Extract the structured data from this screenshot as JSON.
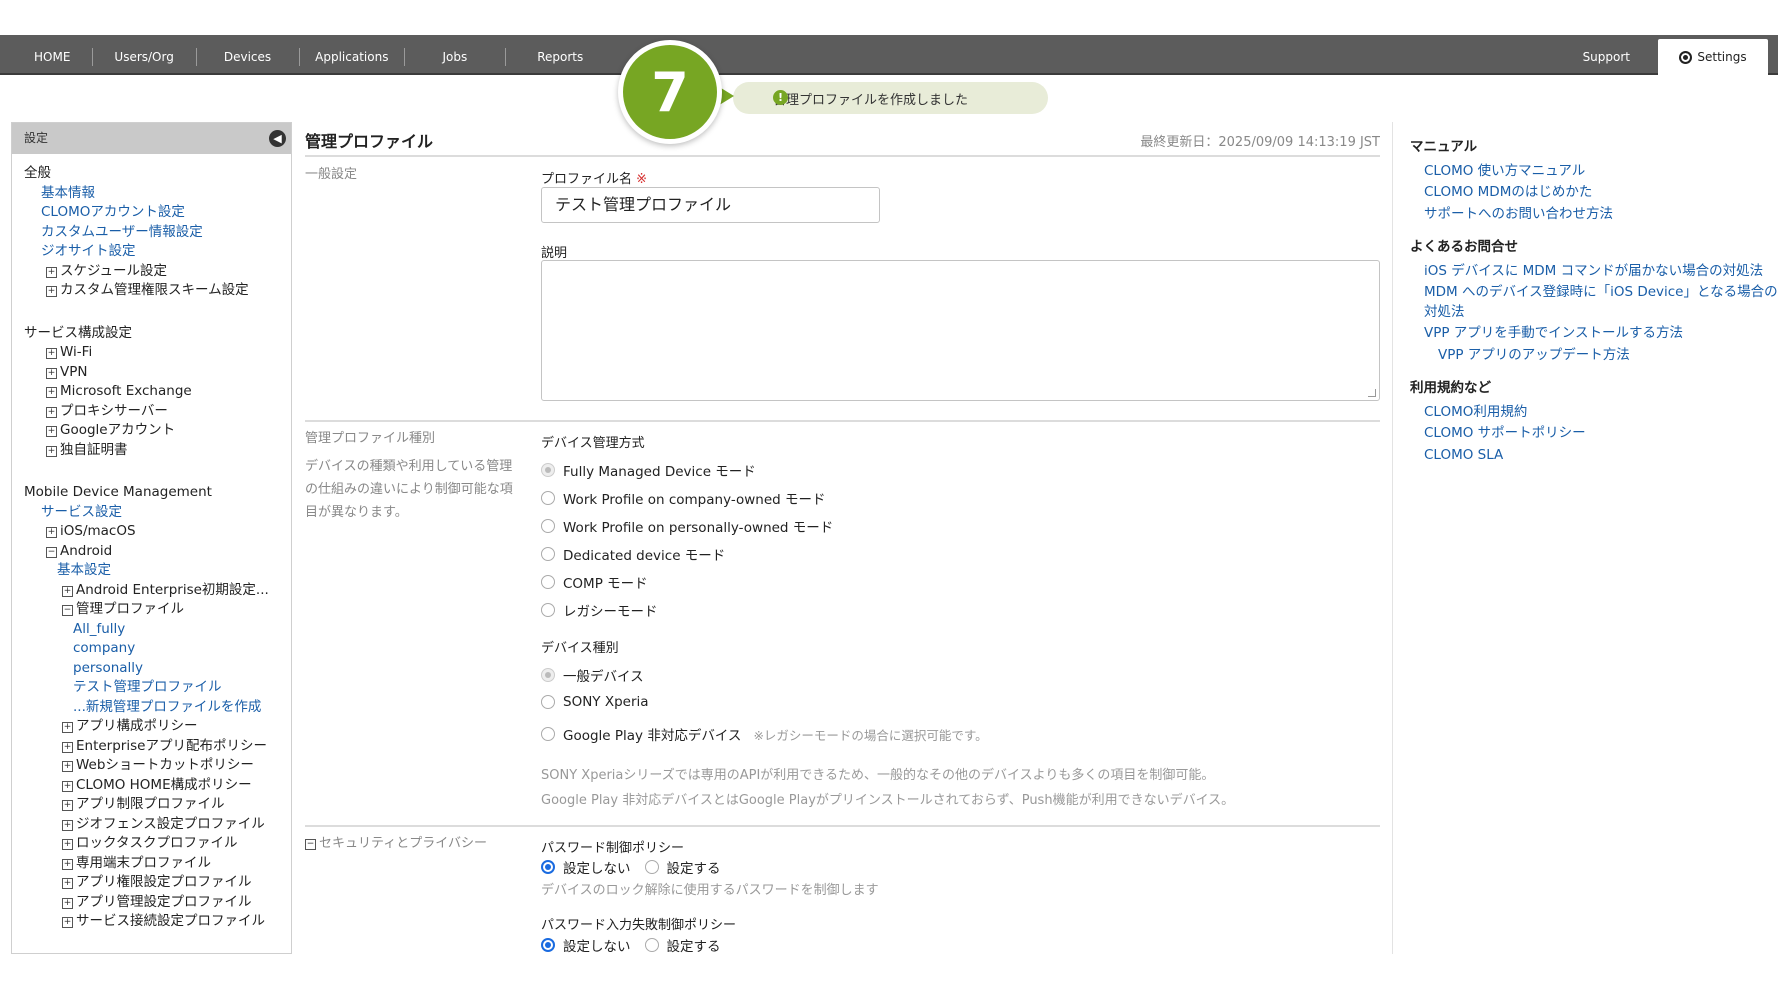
{
  "nav": {
    "items": [
      "HOME",
      "Users/Org",
      "Devices",
      "Applications",
      "Jobs",
      "Reports"
    ],
    "support": "Support",
    "settings": "Settings"
  },
  "callout": {
    "step": "7",
    "message": "管理プロファイルを作成しました"
  },
  "sidebar": {
    "header": "設定",
    "general": {
      "title": "全般",
      "links": [
        "基本情報",
        "CLOMOアカウント設定",
        "カスタムユーザー情報設定",
        "ジオサイト設定"
      ],
      "expandables": [
        "スケジュール設定",
        "カスタム管理権限スキーム設定"
      ]
    },
    "service": {
      "title": "サービス構成設定",
      "items": [
        "Wi-Fi",
        "VPN",
        "Microsoft Exchange",
        "プロキシサーバー",
        "Googleアカウント",
        "独自証明書"
      ]
    },
    "mdm": {
      "title": "Mobile Device Management",
      "service_settings": "サービス設定",
      "ios": "iOS/macOS",
      "android": "Android",
      "android_basic": "基本設定",
      "android_enterprise": "Android Enterprise初期設定...",
      "managed_profile": "管理プロファイル",
      "profiles": [
        "All_fully",
        "company",
        "personally",
        "テスト管理プロファイル",
        "...新規管理プロファイルを作成"
      ],
      "more": [
        "アプリ構成ポリシー",
        "Enterpriseアプリ配布ポリシー",
        "Webショートカットポリシー",
        "CLOMO HOME構成ポリシー",
        "アプリ制限プロファイル",
        "ジオフェンス設定プロファイル",
        "ロックタスクプロファイル",
        "専用端末プロファイル",
        "アプリ権限設定プロファイル",
        "アプリ管理設定プロファイル",
        "サービス接続設定プロファイル"
      ]
    }
  },
  "main": {
    "title": "管理プロファイル",
    "updated": "最終更新日：2025/09/09 14:13:19 JST",
    "general_section": "一般設定",
    "profile_name_label": "プロファイル名",
    "required_mark": "※",
    "profile_name_value": "テスト管理プロファイル",
    "description_label": "説明",
    "type_section": "管理プロファイル種別",
    "type_help": [
      "デバイスの種類や利用している管理",
      "の仕組みの違いにより制御可能な項",
      "目が異なります。"
    ],
    "mgmt_method_label": "デバイス管理方式",
    "mgmt_methods": [
      "Fully Managed Device モード",
      "Work Profile on company-owned モード",
      "Work Profile on personally-owned モード",
      "Dedicated device モード",
      "COMP モード",
      "レガシーモード"
    ],
    "device_type_label": "デバイス種別",
    "device_types": [
      "一般デバイス",
      "SONY Xperia",
      "Google Play 非対応デバイス"
    ],
    "device_type_note": "※レガシーモードの場合に選択可能です。",
    "device_help": [
      "SONY Xperiaシリーズでは専用のAPIが利用できるため、一般的なその他のデバイスよりも多くの項目を制御可能。",
      "Google Play 非対応デバイスとはGoogle Playがプリインストールされておらず、Push機能が利用できないデバイス。"
    ],
    "security_section": "セキュリティとプライバシー",
    "pw_policy_label": "パスワード制御ポリシー",
    "opt_off": "設定しない",
    "opt_on": "設定する",
    "pw_policy_help": "デバイスのロック解除に使用するパスワードを制御します",
    "pw_fail_label": "パスワード入力失敗制御ポリシー"
  },
  "right": {
    "manual_title": "マニュアル",
    "manual_links": [
      "CLOMO 使い方マニュアル",
      "CLOMO MDMのはじめかた",
      "サポートへのお問い合わせ方法"
    ],
    "faq_title": "よくあるお問合せ",
    "faq_links": [
      "iOS デバイスに MDM コマンドが届かない場合の対処法",
      "MDM へのデバイス登録時に「iOS Device」となる場合の対処法",
      "VPP アプリを手動でインストールする方法"
    ],
    "faq_sub": "VPP アプリのアップデート方法",
    "terms_title": "利用規約など",
    "terms_links": [
      "CLOMO利用規約",
      "CLOMO サポートポリシー",
      "CLOMO SLA"
    ]
  }
}
